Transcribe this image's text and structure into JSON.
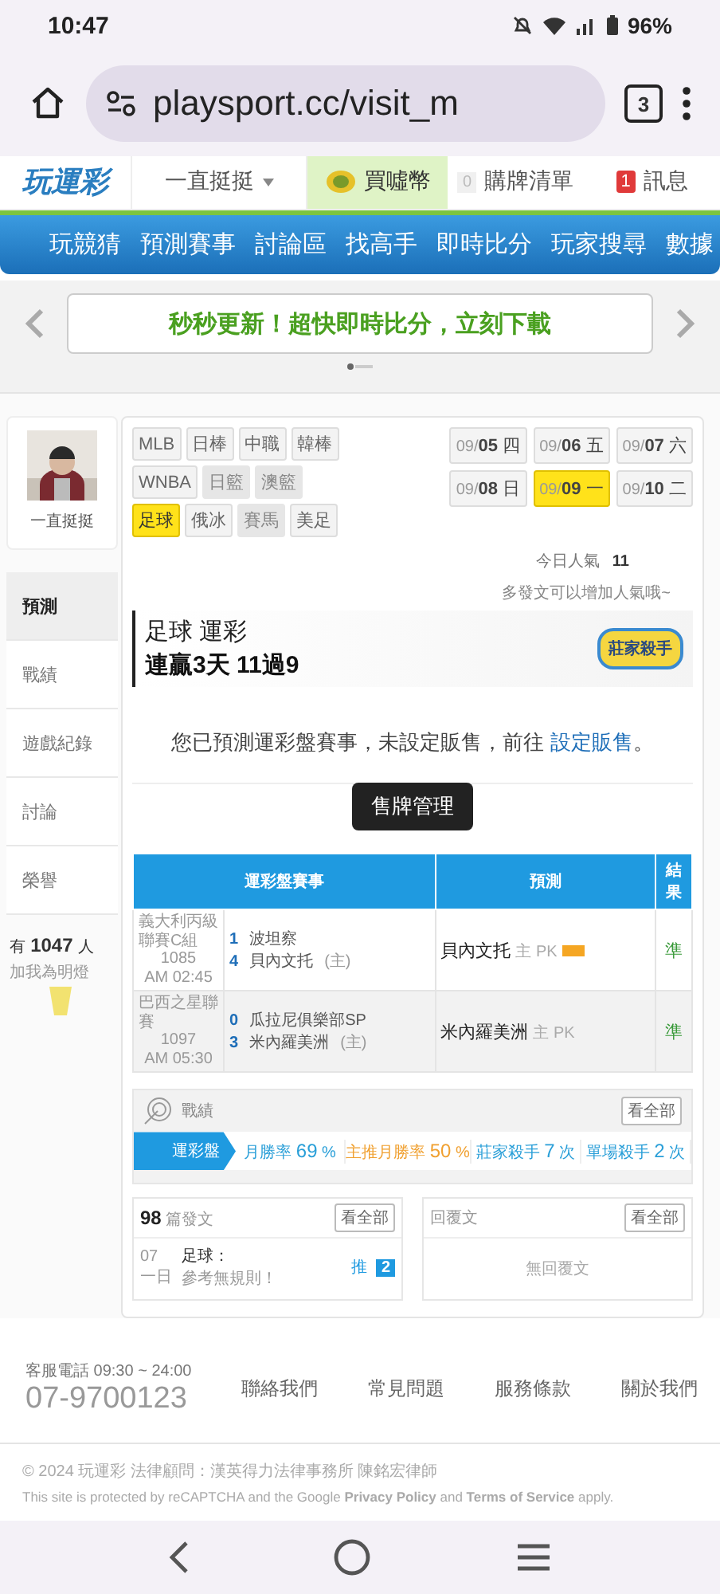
{
  "status_bar": {
    "time": "10:47",
    "battery": "96%"
  },
  "browser": {
    "url": "playsport.cc/visit_m",
    "tab_count": "3"
  },
  "site_header": {
    "logo": "玩運彩",
    "user_menu": "一直挺挺",
    "coin_button": "買噓幣",
    "cart": {
      "count": "0",
      "label": "購牌清單"
    },
    "messages": {
      "count": "1",
      "label": "訊息"
    }
  },
  "nav": [
    "玩競猜",
    "預測賽事",
    "討論區",
    "找高手",
    "即時比分",
    "玩家搜尋",
    "數據"
  ],
  "banner": {
    "text": "秒秒更新！超快即時比分，立刻下載"
  },
  "profile": {
    "name": "一直挺挺"
  },
  "sidebar": [
    {
      "label": "預測",
      "selected": true
    },
    {
      "label": "戰績",
      "selected": false
    },
    {
      "label": "遊戲紀錄",
      "selected": false
    },
    {
      "label": "討論",
      "selected": false
    },
    {
      "label": "榮譽",
      "selected": false
    }
  ],
  "fans": {
    "prefix": "有",
    "count": "1047",
    "suffix": "人",
    "note": "加我為明燈"
  },
  "sport_rows": [
    {
      "items": [
        {
          "label": "MLB",
          "selected": false,
          "disabled": false
        },
        {
          "label": "日棒",
          "selected": false,
          "disabled": false
        },
        {
          "label": "中職",
          "selected": false,
          "disabled": false
        },
        {
          "label": "韓棒",
          "selected": false,
          "disabled": false
        }
      ]
    },
    {
      "items": [
        {
          "label": "WNBA",
          "selected": false,
          "disabled": false
        },
        {
          "label": "日籃",
          "selected": false,
          "disabled": true
        },
        {
          "label": "澳籃",
          "selected": false,
          "disabled": true
        }
      ]
    },
    {
      "items": [
        {
          "label": "足球",
          "selected": true,
          "disabled": false
        },
        {
          "label": "俄冰",
          "selected": false,
          "disabled": false
        },
        {
          "label": "賽馬",
          "selected": false,
          "disabled": true
        },
        {
          "label": "美足",
          "selected": false,
          "disabled": false
        }
      ]
    }
  ],
  "dates": [
    {
      "month": "09/",
      "day": "05",
      "weekday": "四",
      "selected": false
    },
    {
      "month": "09/",
      "day": "06",
      "weekday": "五",
      "selected": false
    },
    {
      "month": "09/",
      "day": "07",
      "weekday": "六",
      "selected": false
    },
    {
      "month": "09/",
      "day": "08",
      "weekday": "日",
      "selected": false
    },
    {
      "month": "09/",
      "day": "09",
      "weekday": "一",
      "selected": true
    },
    {
      "month": "09/",
      "day": "10",
      "weekday": "二",
      "selected": false
    }
  ],
  "popularity": {
    "label": "今日人氣",
    "value": "11",
    "hint": "多發文可以增加人氣哦~"
  },
  "record": {
    "title": "足球 運彩",
    "streak": "連贏3天 11過9",
    "badge": "莊家殺手"
  },
  "notice": {
    "text": "您已預測運彩盤賽事，未設定販售，前往",
    "link": "設定販售",
    "end": "。"
  },
  "manage_button": "售牌管理",
  "table": {
    "columns": [
      "運彩盤賽事",
      "預測",
      "結果"
    ],
    "rows": [
      {
        "league": "義大利丙級聯賽C組",
        "number": "1085",
        "time": "AM 02:45",
        "home_score": "1",
        "home": "波坦察",
        "away_score": "4",
        "away": "貝內文托",
        "away_tag": "(主)",
        "pick": "貝內文托",
        "pick_side": "主 PK",
        "hot": true,
        "result": "準"
      },
      {
        "league": "巴西之星聯賽",
        "number": "1097",
        "time": "AM 05:30",
        "home_score": "0",
        "home": "瓜拉尼俱樂部SP",
        "away_score": "3",
        "away": "米內羅美洲",
        "away_tag": "(主)",
        "pick": "米內羅美洲",
        "pick_side": "主 PK",
        "hot": false,
        "result": "準"
      }
    ]
  },
  "stats": {
    "title": "戰績",
    "more": "看全部",
    "tab": "運彩盤",
    "items": [
      {
        "label": "月勝率",
        "value": "69",
        "unit": "%",
        "color": "#2a9fd8"
      },
      {
        "label": "主推月勝率",
        "value": "50",
        "unit": "%",
        "color": "#f0a030"
      },
      {
        "label": "莊家殺手",
        "value": "7",
        "unit": "次",
        "color": "#2a9fd8"
      },
      {
        "label": "單場殺手",
        "value": "2",
        "unit": "次",
        "color": "#2a9fd8"
      }
    ]
  },
  "posts": {
    "count": "98",
    "label": "篇發文",
    "more": "看全部",
    "item": {
      "date": "07",
      "sub": "一日",
      "title": "足球：",
      "text": "參考無規則！",
      "push": "推",
      "push_count": "2"
    }
  },
  "replies": {
    "label": "回覆文",
    "more": "看全部",
    "empty": "無回覆文"
  },
  "footer": {
    "phone_label": "客服電話 09:30 ~ 24:00",
    "phone": "07-9700123",
    "links": [
      "聯絡我們",
      "常見問題",
      "服務條款",
      "關於我們"
    ],
    "copyright": "© 2024 玩運彩 法律顧問：漢英得力法律事務所 陳銘宏律師",
    "recaptcha": "This site is protected by reCAPTCHA and the Google **Privacy Policy** and **Terms of Service** apply."
  }
}
